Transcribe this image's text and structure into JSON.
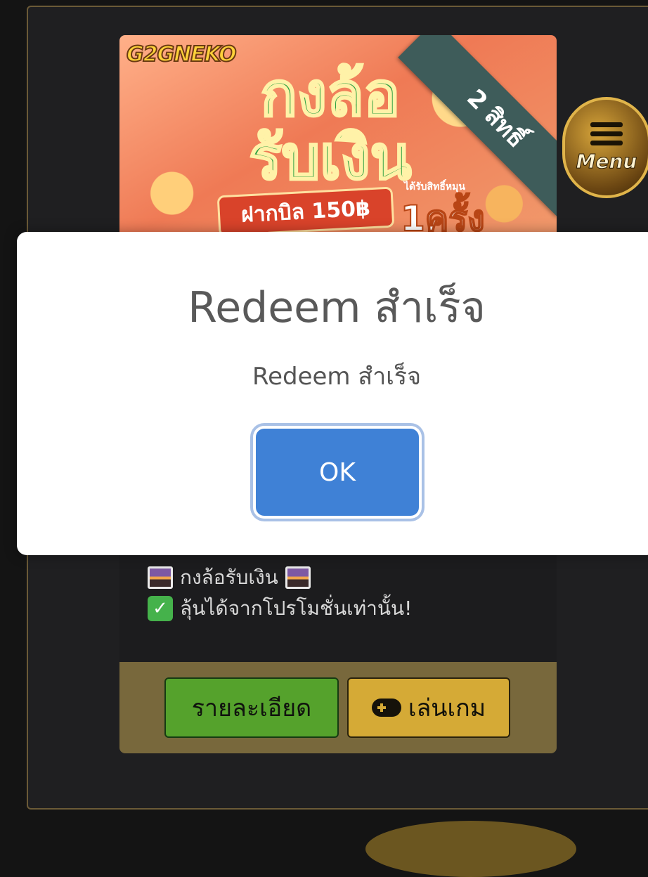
{
  "banner": {
    "brand": "G2GNEKO",
    "title_line1": "กงล้อ",
    "title_line2": "รับเงิน",
    "deposit_ribbon": "ฝากบิล 150฿",
    "spin_note": "ได้รับสิทธิ์หมุน",
    "spin_count": "1ครั้ง",
    "corner_ribbon": "2 สิทธิ์"
  },
  "menu": {
    "label": "Menu"
  },
  "promo": {
    "line1": "กงล้อรับเงิน",
    "line2": "ลุ้นได้จากโปรโมชั่นเท่านั้น!"
  },
  "footer": {
    "details_label": "รายละเอียด",
    "play_label": "เล่นเกม"
  },
  "modal": {
    "title": "Redeem สำเร็จ",
    "text": "Redeem สำเร็จ",
    "ok_label": "OK"
  },
  "colors": {
    "ok_button": "#3f81d6",
    "details_button": "#55a22c",
    "play_button": "#d5aa36"
  }
}
